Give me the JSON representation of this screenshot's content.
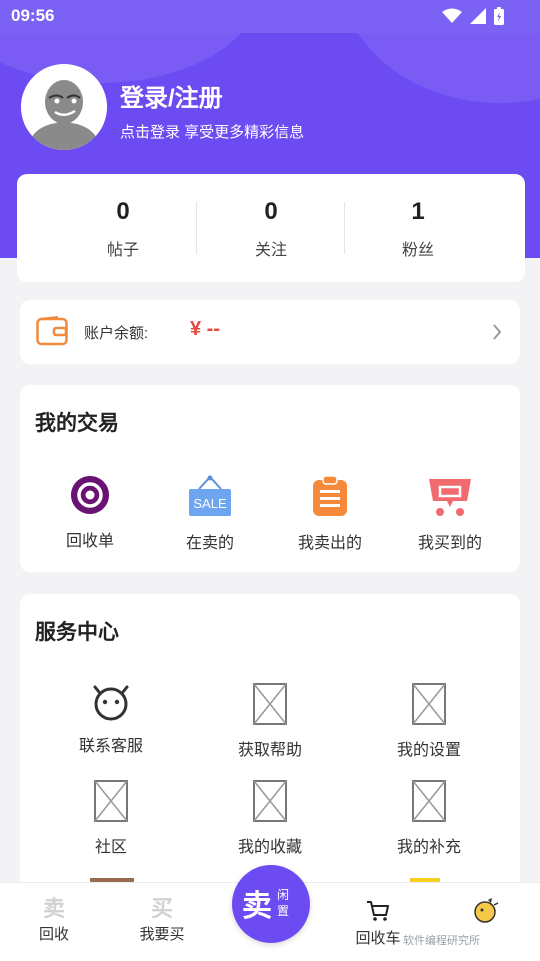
{
  "status_bar": {
    "time": "09:56"
  },
  "profile": {
    "title": "登录/注册",
    "subtitle": "点击登录 享受更多精彩信息"
  },
  "stats": [
    {
      "value": "0",
      "label": "帖子"
    },
    {
      "value": "0",
      "label": "关注"
    },
    {
      "value": "1",
      "label": "粉丝"
    }
  ],
  "balance": {
    "label": "账户余额:",
    "value": "¥ --"
  },
  "trade": {
    "title": "我的交易",
    "items": [
      {
        "label": "回收单",
        "icon": "recycle-order-icon"
      },
      {
        "label": "在卖的",
        "icon": "sale-sign-icon"
      },
      {
        "label": "我卖出的",
        "icon": "clipboard-icon"
      },
      {
        "label": "我买到的",
        "icon": "cart-bag-icon"
      }
    ]
  },
  "service": {
    "title": "服务中心",
    "items": [
      {
        "label": "联系客服",
        "icon": "customer-service-icon"
      },
      {
        "label": "获取帮助",
        "icon": "broken-image-icon"
      },
      {
        "label": "我的设置",
        "icon": "broken-image-icon"
      },
      {
        "label": "社区",
        "icon": "broken-image-icon"
      },
      {
        "label": "我的收藏",
        "icon": "broken-image-icon"
      },
      {
        "label": "我的补充",
        "icon": "broken-image-icon"
      }
    ]
  },
  "bottom_nav": {
    "items": [
      {
        "label": "回收",
        "glyph": "卖"
      },
      {
        "label": "我要买",
        "glyph": "买"
      },
      {
        "label": "回收车",
        "icon": "cart-icon"
      },
      {
        "label": "",
        "icon": "chick-icon"
      }
    ],
    "sell_button": {
      "main": "卖",
      "sub": "闲置"
    }
  },
  "watermark": "软件编程研究所",
  "colors": {
    "primary": "#6c4cf2",
    "price_red": "#e3483e",
    "background": "#f3f3f6"
  }
}
